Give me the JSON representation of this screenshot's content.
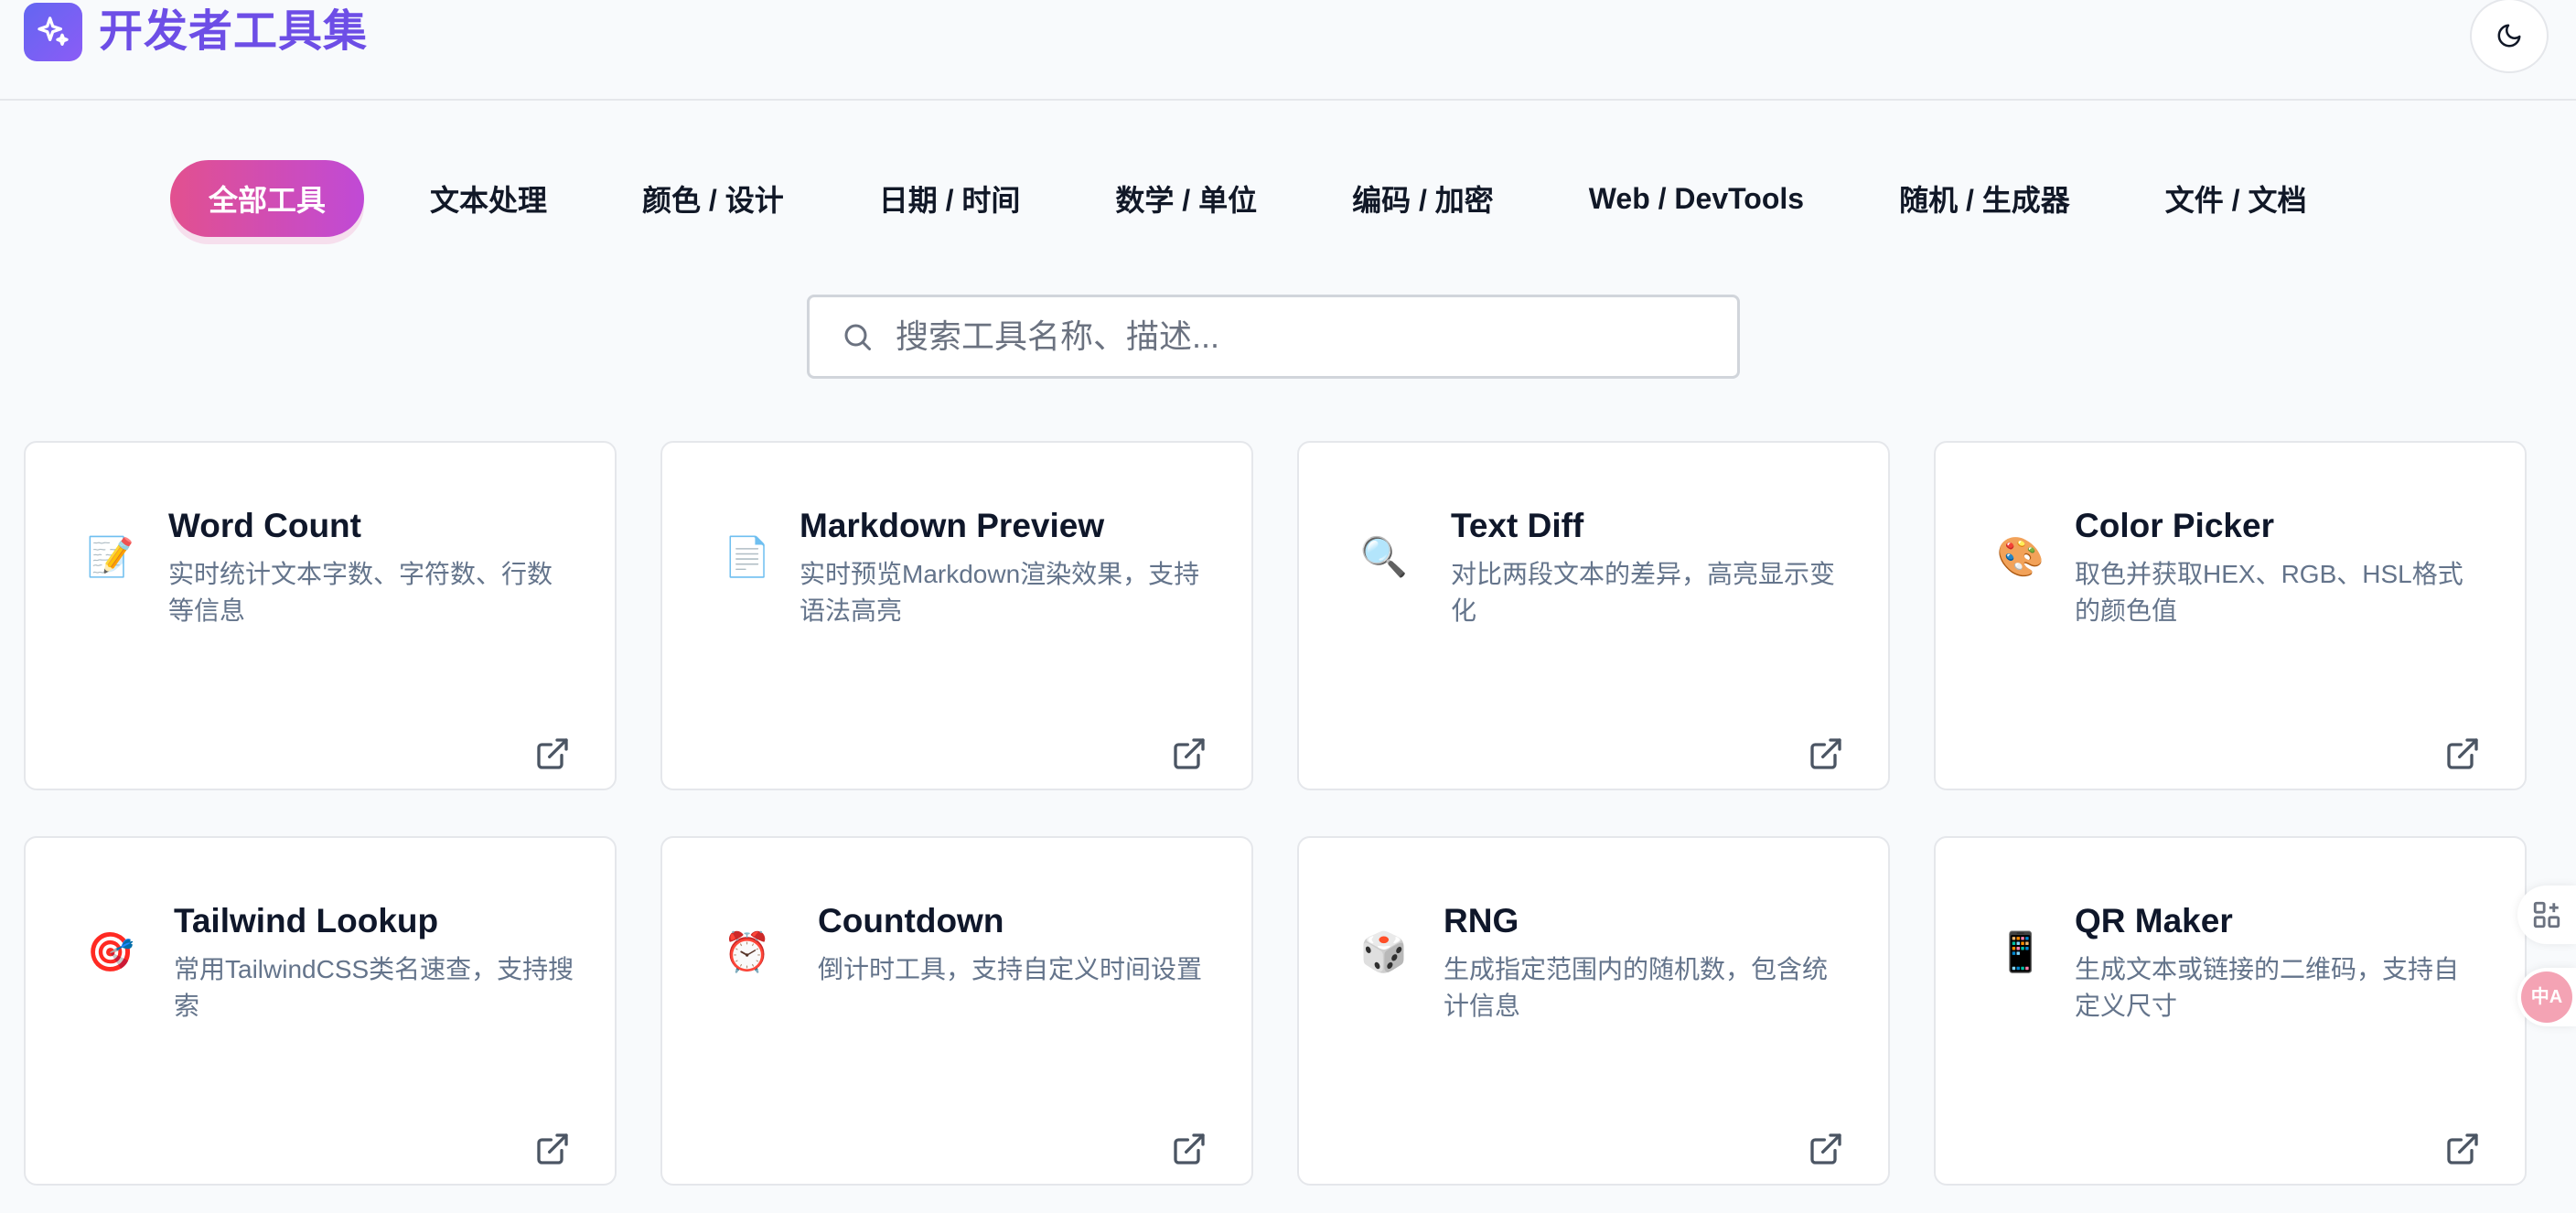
{
  "brand": {
    "title": "开发者工具集"
  },
  "tabs": [
    {
      "label": "全部工具",
      "active": true
    },
    {
      "label": "文本处理",
      "active": false
    },
    {
      "label": "颜色 / 设计",
      "active": false
    },
    {
      "label": "日期 / 时间",
      "active": false
    },
    {
      "label": "数学 / 单位",
      "active": false
    },
    {
      "label": "编码 / 加密",
      "active": false
    },
    {
      "label": "Web / DevTools",
      "active": false
    },
    {
      "label": "随机 / 生成器",
      "active": false
    },
    {
      "label": "文件 / 文档",
      "active": false
    }
  ],
  "search": {
    "placeholder": "搜索工具名称、描述...",
    "value": ""
  },
  "cards": [
    {
      "emoji": "📝",
      "icon": "memo-icon",
      "title": "Word Count",
      "desc": "实时统计文本字数、字符数、行数等信息"
    },
    {
      "emoji": "📄",
      "icon": "document-icon",
      "title": "Markdown Preview",
      "desc": "实时预览Markdown渲染效果，支持语法高亮"
    },
    {
      "emoji": "🔍",
      "icon": "magnifier-icon",
      "title": "Text Diff",
      "desc": "对比两段文本的差异，高亮显示变化"
    },
    {
      "emoji": "🎨",
      "icon": "palette-icon",
      "title": "Color Picker",
      "desc": "取色并获取HEX、RGB、HSL格式的颜色值"
    },
    {
      "emoji": "🎯",
      "icon": "target-icon",
      "title": "Tailwind Lookup",
      "desc": "常用TailwindCSS类名速查，支持搜索"
    },
    {
      "emoji": "⏰",
      "icon": "alarm-clock-icon",
      "title": "Countdown",
      "desc": "倒计时工具，支持自定义时间设置"
    },
    {
      "emoji": "🎲",
      "icon": "dice-icon",
      "title": "RNG",
      "desc": "生成指定范围内的随机数，包含统计信息"
    },
    {
      "emoji": "📱",
      "icon": "mobile-phone-icon",
      "title": "QR Maker",
      "desc": "生成文本或链接的二维码，支持自定义尺寸"
    }
  ],
  "side_widgets": {
    "translate_label": "中A"
  },
  "colors": {
    "brand": "#6d4ee6",
    "active_tab_start": "#e2508f",
    "active_tab_end": "#c04ad6"
  }
}
